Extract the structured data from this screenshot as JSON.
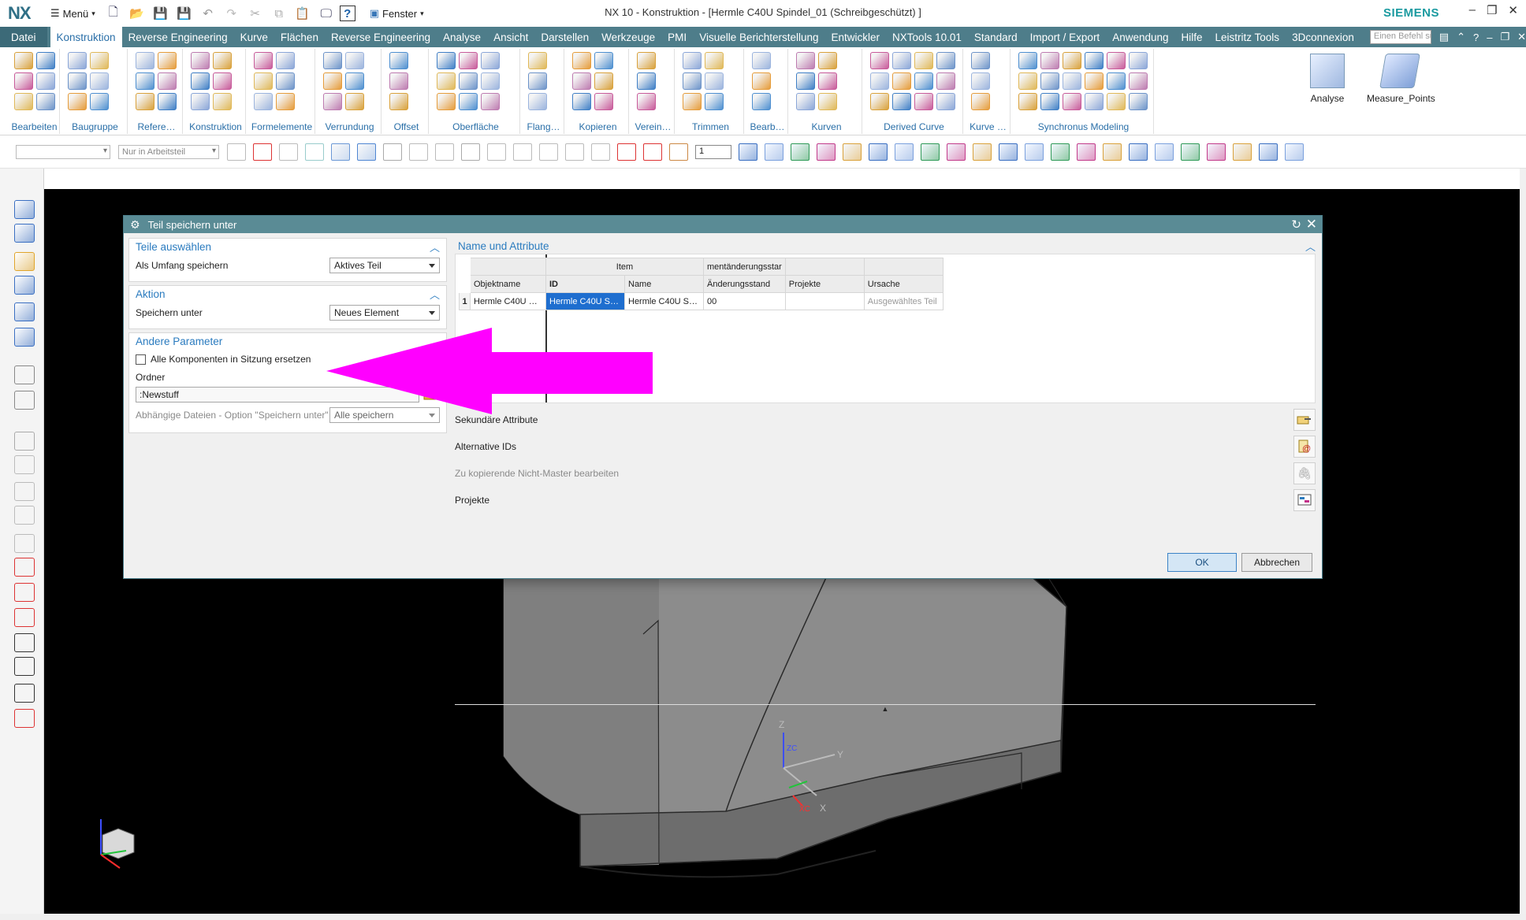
{
  "app": {
    "logo": "NX",
    "menu_label": "Menü",
    "window_menu_label": "Fenster",
    "window_title": "NX 10 - Konstruktion - [Hermle C40U Spindel_01 (Schreibgeschützt) ]",
    "brand": "SIEMENS"
  },
  "ribbon_tabs": [
    {
      "label": "Datei",
      "state": "file"
    },
    {
      "label": "Konstruktion",
      "state": "active"
    },
    {
      "label": "Reverse Engineering",
      "state": ""
    },
    {
      "label": "Kurve",
      "state": ""
    },
    {
      "label": "Flächen",
      "state": ""
    },
    {
      "label": "Reverse Engineering",
      "state": ""
    },
    {
      "label": "Analyse",
      "state": ""
    },
    {
      "label": "Ansicht",
      "state": ""
    },
    {
      "label": "Darstellen",
      "state": ""
    },
    {
      "label": "Werkzeuge",
      "state": ""
    },
    {
      "label": "PMI",
      "state": ""
    },
    {
      "label": "Visuelle Berichterstellung",
      "state": ""
    },
    {
      "label": "Entwickler",
      "state": ""
    },
    {
      "label": "NXTools 10.01",
      "state": ""
    },
    {
      "label": "Standard",
      "state": ""
    },
    {
      "label": "Import / Export",
      "state": ""
    },
    {
      "label": "Anwendung",
      "state": ""
    },
    {
      "label": "Hilfe",
      "state": ""
    },
    {
      "label": "Leistritz Tools",
      "state": ""
    },
    {
      "label": "3Dconnexion",
      "state": ""
    }
  ],
  "search_placeholder": "Einen Befehl such",
  "ribbon_groups": [
    "Bearbeiten",
    "Baugruppe",
    "Refere…",
    "Konstruktion",
    "Formelemente",
    "Verrundung",
    "Offset",
    "Oberfläche",
    "Flang…",
    "Kopieren",
    "Verein…",
    "Trimmen",
    "Bearb…",
    "Kurven",
    "Derived Curve",
    "Kurve …",
    "Synchronus Modeling"
  ],
  "ribbon_big_tools": {
    "analyse": "Analyse",
    "measure_points": "Measure_Points"
  },
  "toolbar2": {
    "filter_placeholder": "",
    "scope_label": "Nur in Arbeitsteil",
    "spin_value": "1"
  },
  "dialog": {
    "title": "Teil speichern unter",
    "sections": {
      "select_parts": {
        "title": "Teile auswählen",
        "save_as_scope_label": "Als Umfang speichern",
        "save_as_scope_value": "Aktives Teil"
      },
      "action": {
        "title": "Aktion",
        "save_under_label": "Speichern unter",
        "save_under_value": "Neues Element"
      },
      "other": {
        "title": "Andere Parameter",
        "replace_all_label": "Alle Komponenten in Sitzung ersetzen",
        "replace_all_checked": false,
        "folder_label": "Ordner",
        "folder_value": ":Newstuff",
        "dependent_label": "Abhängige Dateien - Option \"Speichern unter\"",
        "dependent_value": "Alle speichern"
      }
    },
    "name_attr": {
      "title": "Name und Attribute",
      "group_headers": {
        "item": "Item",
        "revision": "mentänderungsstar"
      },
      "columns": [
        "Objektname",
        "ID",
        "Name",
        "Änderungsstand",
        "Projekte",
        "Ursache"
      ],
      "rows": [
        {
          "index": "1",
          "objektname": "Hermle C40U Spi…",
          "id": "Hermle C40U Spi…",
          "name": "Hermle C40U Spi…",
          "aenderungsstand": "00",
          "projekte": "",
          "ursache": "Ausgewähltes Teil"
        }
      ]
    },
    "attribute_rows": [
      {
        "label": "Sekundäre Attribute",
        "enabled": true,
        "icon": "secondary-attributes-icon"
      },
      {
        "label": "Alternative IDs",
        "enabled": true,
        "icon": "alternative-ids-icon"
      },
      {
        "label": "Zu kopierende Nicht-Master bearbeiten",
        "enabled": false,
        "icon": "paperclip-icon"
      },
      {
        "label": "Projekte",
        "enabled": true,
        "icon": "projects-icon"
      }
    ],
    "ok_label": "OK",
    "cancel_label": "Abbrechen"
  },
  "viewport": {
    "triad_labels": {
      "x": "X",
      "y": "Y",
      "z": "Z",
      "zc": "ZC",
      "xc": "XC"
    }
  },
  "colors": {
    "tab_bar": "#4e7d8a",
    "dialog_title": "#5a8b95",
    "accent_blue": "#2a7bbf",
    "selection": "#1e6ecf",
    "annotation_arrow": "#ff00ff",
    "brand": "#1a9aa0"
  }
}
